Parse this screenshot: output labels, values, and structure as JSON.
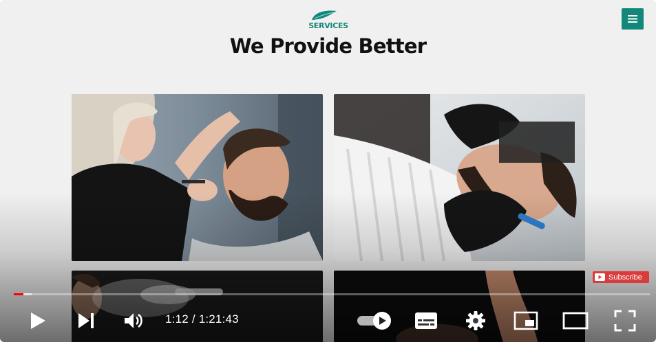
{
  "site": {
    "logo_text": "SERVICES",
    "heading": "We Provide Better",
    "accent_color": "#12877a"
  },
  "icons": {
    "menu": "hamburger-menu-icon",
    "play": "play-icon",
    "next": "skip-next-icon",
    "volume": "volume-icon",
    "autoplay": "autoplay-toggle-icon",
    "captions": "subtitles-icon",
    "settings": "gear-icon",
    "miniplayer": "miniplayer-icon",
    "theater": "theater-mode-icon",
    "fullscreen": "fullscreen-icon"
  },
  "player": {
    "subscribe_label": "Subscribe",
    "current_time": "1:12",
    "duration": "1:21:43",
    "played_fraction": 0.0147,
    "loaded_fraction": 0.028,
    "progress_color": "#ff0000",
    "subscribe_color": "#d93c3c"
  }
}
